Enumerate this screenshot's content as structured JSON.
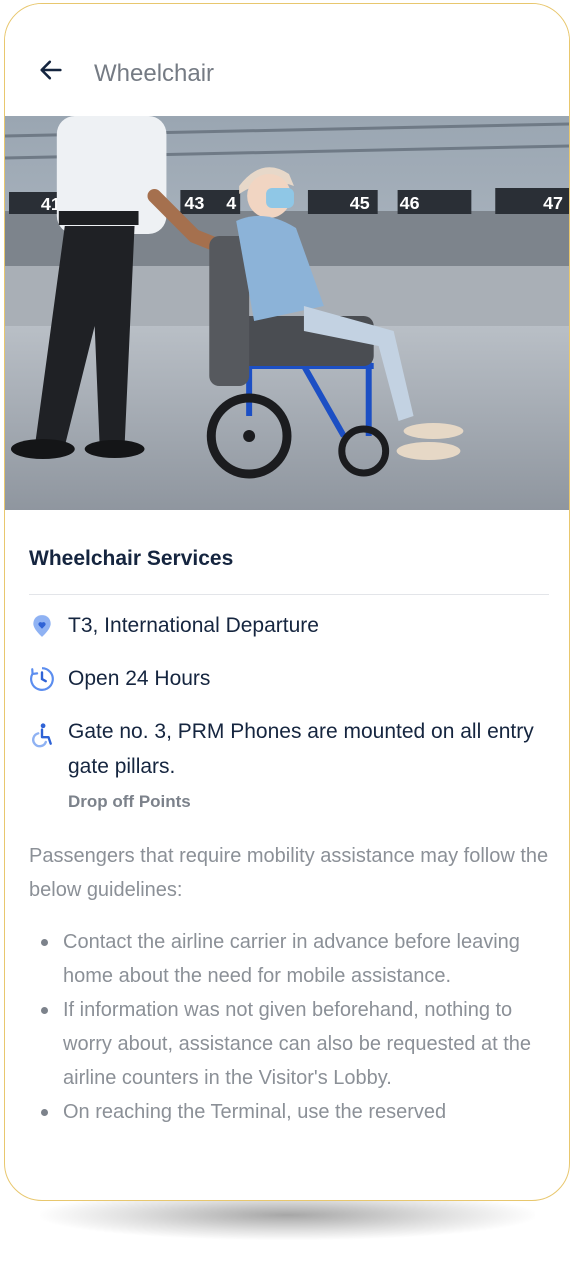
{
  "header": {
    "title": "Wheelchair",
    "back_icon": "arrow-left-icon"
  },
  "hero": {
    "gate_signs": [
      "41",
      "43",
      "4",
      "45",
      "46",
      "47"
    ]
  },
  "service": {
    "title": "Wheelchair Services",
    "location": {
      "icon": "location-pin-icon",
      "text": "T3, International Departure"
    },
    "hours": {
      "icon": "clock-icon",
      "text": "Open 24 Hours"
    },
    "accessibility": {
      "icon": "wheelchair-icon",
      "text": "Gate no. 3, PRM Phones are mounted on all entry gate pillars."
    },
    "sub_label": "Drop off Points"
  },
  "description": "Passengers that require mobility assistance may follow the below guidelines:",
  "guidelines": [
    "Contact the airline carrier in advance before leaving home about the need for mobile assistance.",
    "If information was not given beforehand, nothing to worry about, assistance can also be requested at the airline counters in the Visitor's Lobby.",
    "On reaching the Terminal, use the reserved"
  ],
  "colors": {
    "accent": "#5b8def",
    "text_dark": "#15253f",
    "text_muted": "#8b9097",
    "frame": "#e8c76e"
  }
}
